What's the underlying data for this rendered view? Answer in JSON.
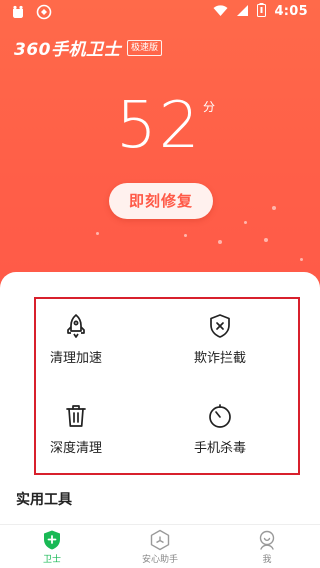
{
  "status_bar": {
    "time": "4:05"
  },
  "brand": {
    "name": "360手机卫士",
    "badge": "极速版"
  },
  "score": {
    "value": "52",
    "unit": "分"
  },
  "repair_button": "即刻修复",
  "features": [
    {
      "label": "清理加速",
      "icon": "rocket-icon"
    },
    {
      "label": "欺诈拦截",
      "icon": "shield-x-icon"
    },
    {
      "label": "深度清理",
      "icon": "trash-icon"
    },
    {
      "label": "手机杀毒",
      "icon": "timer-icon"
    }
  ],
  "section_title": "实用工具",
  "bottom_nav": [
    {
      "label": "卫士",
      "icon": "shield-plus-icon",
      "active": true
    },
    {
      "label": "安心助手",
      "icon": "assistant-icon",
      "active": false
    },
    {
      "label": "我",
      "icon": "profile-icon",
      "active": false
    }
  ],
  "colors": {
    "accent": "#ff5a48",
    "active_nav": "#19b955",
    "highlight_border": "#d8202c"
  }
}
